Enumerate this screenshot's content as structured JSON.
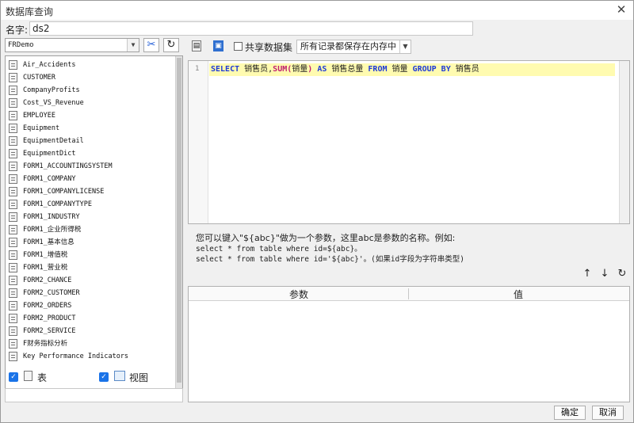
{
  "window": {
    "title": "数据库查询",
    "close": "✕"
  },
  "name_field": {
    "label": "名字:",
    "value": "ds2"
  },
  "datasource": {
    "selected": "FRDemo",
    "arrow": "▼"
  },
  "tables": [
    "Air_Accidents",
    "CUSTOMER",
    "CompanyProfits",
    "Cost_VS_Revenue",
    "EMPLOYEE",
    "Equipment",
    "EquipmentDetail",
    "EquipmentDict",
    "FORM1_ACCOUNTINGSYSTEM",
    "FORM1_COMPANY",
    "FORM1_COMPANYLICENSE",
    "FORM1_COMPANYTYPE",
    "FORM1_INDUSTRY",
    "FORM1_企业所得税",
    "FORM1_基本信息",
    "FORM1_增值税",
    "FORM1_营业税",
    "FORM2_CHANCE",
    "FORM2_CUSTOMER",
    "FORM2_ORDERS",
    "FORM2_PRODUCT",
    "FORM2_SERVICE",
    "F财务指标分析",
    "Key Performance Indicators"
  ],
  "filters": {
    "table_label": "表",
    "view_label": "视图"
  },
  "toolbar": {
    "share_label": "共享数据集",
    "mode_selected": "所有记录都保存在内存中",
    "mode_arrow": "▼"
  },
  "sql": {
    "line_number": "1",
    "tokens": {
      "select": "SELECT",
      "col1": " 销售员,",
      "sum": "SUM",
      "paren_open": "(",
      "arg": "销量",
      "paren_close": ")",
      "as": " AS",
      "alias": " 销售总量 ",
      "from": "FROM",
      "table": " 销量 ",
      "group_by": "GROUP BY",
      "group_col": " 销售员"
    }
  },
  "hint": {
    "line1": "您可以键入\"${abc}\"做为一个参数，这里abc是参数的名称。例如:",
    "line2": "select * from table where id=${abc}。",
    "line3": "select * from table where id='${abc}'。(如果id字段为字符串类型)"
  },
  "param_buttons": {
    "up": "↑",
    "down": "↓",
    "refresh": "↻"
  },
  "param_table": {
    "col_param": "参数",
    "col_value": "值"
  },
  "footer": {
    "ok": "确定",
    "cancel": "取消"
  },
  "icons": {
    "connect": "✂",
    "refresh": "↻",
    "preview": "🔍",
    "save": "💾"
  },
  "colors": {
    "accent": "#1a73e8",
    "keyword": "#1f3bd6",
    "function": "#c02070",
    "highlight": "#fffbb0"
  }
}
